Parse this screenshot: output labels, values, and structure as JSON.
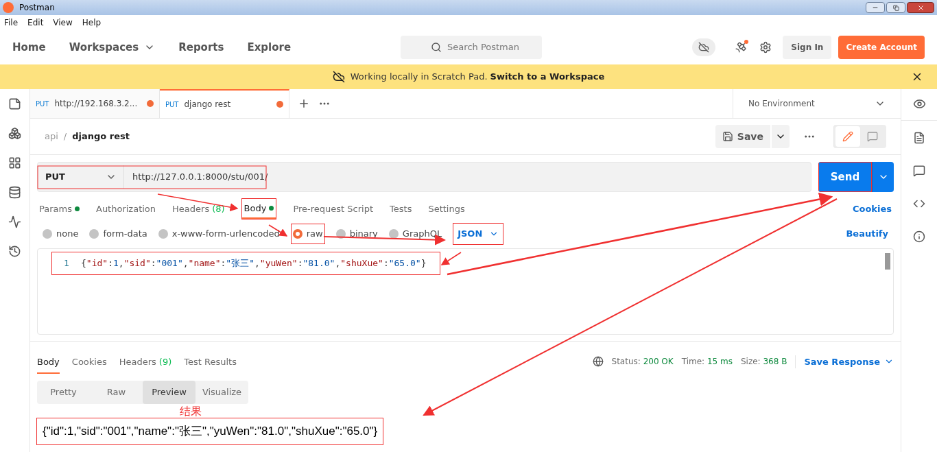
{
  "window": {
    "title": "Postman"
  },
  "menu": [
    "File",
    "Edit",
    "View",
    "Help"
  ],
  "nav": [
    {
      "label": "Home",
      "dropdown": false
    },
    {
      "label": "Workspaces",
      "dropdown": true
    },
    {
      "label": "Reports",
      "dropdown": false
    },
    {
      "label": "Explore",
      "dropdown": false
    }
  ],
  "search": {
    "placeholder": "Search Postman"
  },
  "header_buttons": {
    "sign_in": "Sign In",
    "create": "Create Account"
  },
  "banner": {
    "text": "Working locally in Scratch Pad.",
    "link": "Switch to a Workspace"
  },
  "tabs": [
    {
      "method": "PUT",
      "label": "http://192.168.3.2...",
      "selected": false,
      "unsaved": true
    },
    {
      "method": "PUT",
      "label": "django rest",
      "selected": true,
      "unsaved": true
    }
  ],
  "environment": "No Environment",
  "breadcrumb": {
    "parent": "api",
    "separator": "/",
    "current": "django rest"
  },
  "save": "Save",
  "modes": [
    {
      "kind": "edit",
      "selected": true
    },
    {
      "kind": "comment",
      "selected": false
    }
  ],
  "request": {
    "method": "PUT",
    "url": "http://127.0.0.1:8000/stu/001/",
    "send": "Send"
  },
  "request_tabs": [
    {
      "label": "Params",
      "selected": false,
      "dot": true
    },
    {
      "label": "Authorization",
      "selected": false,
      "dot": false
    },
    {
      "label": "Headers",
      "count": "(8)",
      "selected": false,
      "dot": false
    },
    {
      "label": "Body",
      "selected": true,
      "dot": true
    },
    {
      "label": "Pre-request Script",
      "selected": false,
      "dot": false
    },
    {
      "label": "Tests",
      "selected": false,
      "dot": false
    },
    {
      "label": "Settings",
      "selected": false,
      "dot": false
    }
  ],
  "cookies": "Cookies",
  "body_types": [
    {
      "label": "none",
      "selected": false
    },
    {
      "label": "form-data",
      "selected": false
    },
    {
      "label": "x-www-form-urlencoded",
      "selected": false
    },
    {
      "label": "raw",
      "selected": true
    },
    {
      "label": "binary",
      "selected": false
    },
    {
      "label": "GraphQL",
      "selected": false
    }
  ],
  "format": "JSON",
  "beautify": "Beautify",
  "editor": {
    "line_number": "1",
    "tokens": [
      {
        "kind": "punct",
        "text": "{"
      },
      {
        "kind": "key",
        "text": "\"id\""
      },
      {
        "kind": "punct",
        "text": ":"
      },
      {
        "kind": "value",
        "text": "1"
      },
      {
        "kind": "punct",
        "text": ","
      },
      {
        "kind": "key",
        "text": "\"sid\""
      },
      {
        "kind": "punct",
        "text": ":"
      },
      {
        "kind": "value",
        "text": "\"001\""
      },
      {
        "kind": "punct",
        "text": ","
      },
      {
        "kind": "key",
        "text": "\"name\""
      },
      {
        "kind": "punct",
        "text": ":"
      },
      {
        "kind": "value",
        "text": "\"张三\""
      },
      {
        "kind": "punct",
        "text": ","
      },
      {
        "kind": "key",
        "text": "\"yuWen\""
      },
      {
        "kind": "punct",
        "text": ":"
      },
      {
        "kind": "value",
        "text": "\"81.0\""
      },
      {
        "kind": "punct",
        "text": ","
      },
      {
        "kind": "key",
        "text": "\"shuXue\""
      },
      {
        "kind": "punct",
        "text": ":"
      },
      {
        "kind": "value",
        "text": "\"65.0\""
      },
      {
        "kind": "punct",
        "text": "}"
      }
    ]
  },
  "response_tabs": [
    {
      "label": "Body",
      "selected": true
    },
    {
      "label": "Cookies",
      "selected": false
    },
    {
      "label": "Headers",
      "count": "(9)",
      "selected": false
    },
    {
      "label": "Test Results",
      "selected": false
    }
  ],
  "status": [
    {
      "label": "Status:",
      "value": "200 OK"
    },
    {
      "label": "Time:",
      "value": "15 ms"
    },
    {
      "label": "Size:",
      "value": "368 B"
    }
  ],
  "save_response": "Save Response",
  "view_modes": [
    {
      "label": "Pretty",
      "selected": false
    },
    {
      "label": "Raw",
      "selected": false
    },
    {
      "label": "Preview",
      "selected": true
    },
    {
      "label": "Visualize",
      "selected": false
    }
  ],
  "annotation": "结果",
  "result": "{\"id\":1,\"sid\":\"001\",\"name\":\"张三\",\"yuWen\":\"81.0\",\"shuXue\":\"65.0\"}"
}
